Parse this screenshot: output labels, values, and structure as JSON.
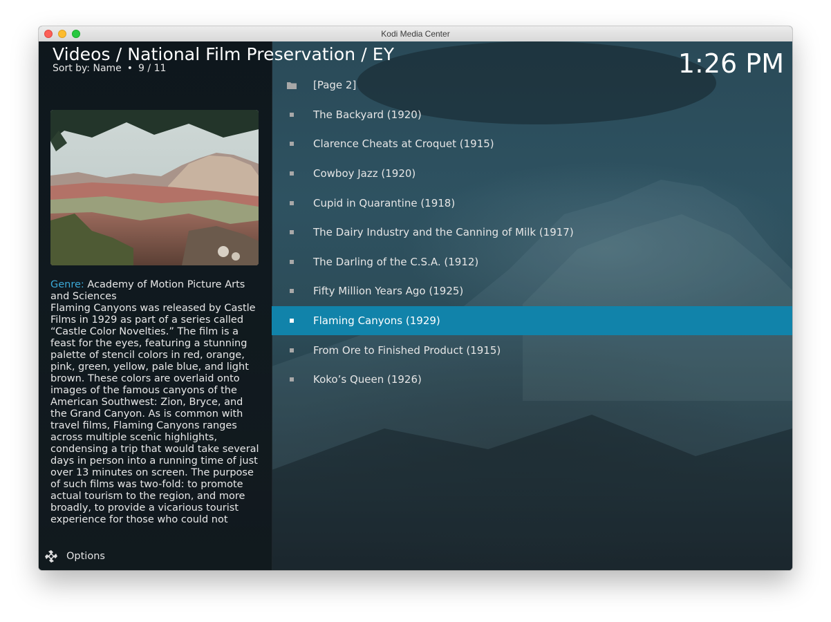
{
  "window": {
    "title": "Kodi Media Center"
  },
  "header": {
    "title": "Videos / National Film Preservation  / EY",
    "sort_label": "Sort by: Name",
    "position": "9 / 11",
    "separator": "•",
    "clock": "1:26 PM"
  },
  "info": {
    "genre_label": "Genre:",
    "genre_value": "Academy of Motion Picture Arts and Sciences",
    "plot": "Flaming Canyons was released by Castle Films in 1929 as part of a series called “Castle Color Novelties.” The film is a feast for the eyes, featuring a stunning palette of stencil colors in red, orange, pink, green, yellow, pale blue, and light brown. These colors are overlaid onto images of the famous canyons of the American Southwest: Zion, Bryce, and the Grand Canyon. As is common with travel films, Flaming Canyons ranges across multiple scenic highlights, condensing a trip that would take several days in person into a running time of just over 13 minutes on screen. The purpose of such films was two-fold: to promote actual tourism to the region, and more broadly, to provide a vicarious tourist experience for those who could not"
  },
  "options": {
    "label": "Options",
    "icon": "options-icon"
  },
  "list": {
    "items": [
      {
        "label": "[Page 2]",
        "icon": "folder-icon"
      },
      {
        "label": "The Backyard (1920)"
      },
      {
        "label": "Clarence Cheats at Croquet (1915)"
      },
      {
        "label": "Cowboy Jazz (1920)"
      },
      {
        "label": "Cupid in Quarantine (1918)"
      },
      {
        "label": "The Dairy Industry and the Canning of Milk (1917)"
      },
      {
        "label": "The Darling of the C.S.A. (1912)"
      },
      {
        "label": "Fifty Million Years Ago (1925)"
      },
      {
        "label": "Flaming Canyons (1929)",
        "selected": true
      },
      {
        "label": "From Ore to Finished Product (1915)"
      },
      {
        "label": "Koko’s Queen (1926)"
      }
    ]
  },
  "colors": {
    "selection": "#1183aa",
    "genre_label": "#3ba8d6"
  }
}
